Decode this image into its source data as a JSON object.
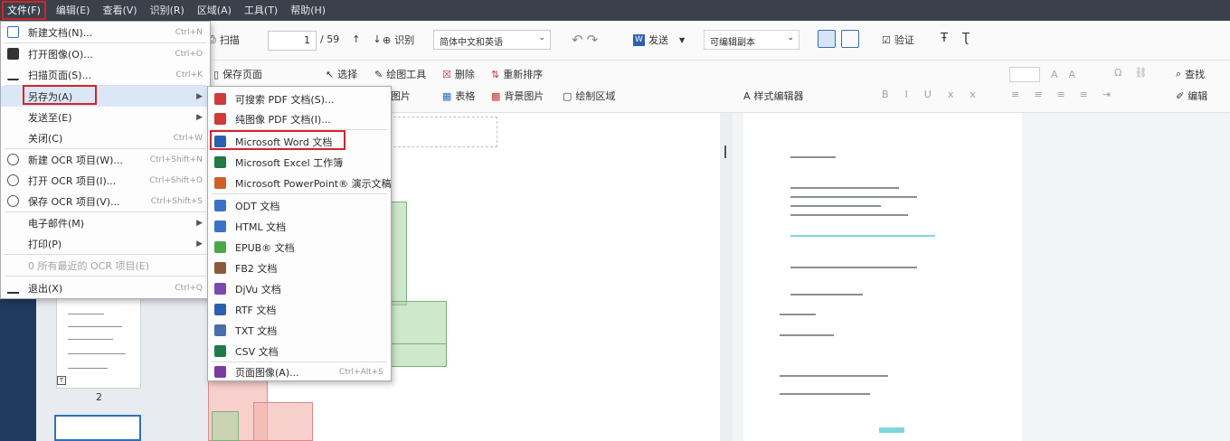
{
  "menubar": {
    "items": [
      "文件(F)",
      "编辑(E)",
      "查看(V)",
      "识别(R)",
      "区域(A)",
      "工具(T)",
      "帮助(H)"
    ]
  },
  "toolbar": {
    "scan": "扫描",
    "page_value": "1",
    "page_total": "/ 59",
    "recognize": "识别",
    "language": "简体中文和英语",
    "send": "发送",
    "send_target": "可编辑副本",
    "verify": "验证"
  },
  "toolbar2": {
    "save_page": "保存页面",
    "select": "选择",
    "draw_tools": "绘图工具",
    "delete": "删除",
    "reorder": "重新排序",
    "picture": "图片",
    "table": "表格",
    "bg_picture": "背景图片",
    "draw_region": "绘制区域",
    "style_editor": "样式编辑器",
    "find": "查找",
    "edit": "编辑"
  },
  "thumbs": {
    "page2_num": "2"
  },
  "file_menu": {
    "items": [
      {
        "label": "新建文档(N)...",
        "shortcut": "Ctrl+N",
        "icon": "new-doc-icon",
        "arrow": false
      },
      {
        "label": "打开图像(O)...",
        "shortcut": "Ctrl+O",
        "icon": "folder-icon",
        "arrow": false
      },
      {
        "label": "扫描页面(S)...",
        "shortcut": "Ctrl+K",
        "icon": "scan-icon",
        "arrow": false
      },
      {
        "label": "另存为(A)",
        "shortcut": "",
        "icon": "",
        "arrow": true
      },
      {
        "label": "发送至(E)",
        "shortcut": "",
        "icon": "",
        "arrow": true
      },
      {
        "label": "关闭(C)",
        "shortcut": "Ctrl+W",
        "icon": "",
        "arrow": false
      },
      {
        "label": "新建 OCR 项目(W)...",
        "shortcut": "Ctrl+Shift+N",
        "icon": "ocr-new-icon",
        "arrow": false
      },
      {
        "label": "打开 OCR 项目(I)...",
        "shortcut": "Ctrl+Shift+O",
        "icon": "ocr-open-icon",
        "arrow": false
      },
      {
        "label": "保存 OCR 项目(V)...",
        "shortcut": "Ctrl+Shift+S",
        "icon": "ocr-save-icon",
        "arrow": false
      },
      {
        "label": "电子邮件(M)",
        "shortcut": "",
        "icon": "",
        "arrow": true
      },
      {
        "label": "打印(P)",
        "shortcut": "",
        "icon": "",
        "arrow": true
      },
      {
        "label": "0 所有最近的 OCR 项目(E)",
        "shortcut": "",
        "icon": "",
        "arrow": false
      },
      {
        "label": "退出(X)",
        "shortcut": "Ctrl+Q",
        "icon": "exit-icon",
        "arrow": false
      }
    ]
  },
  "saveas_menu": {
    "items": [
      {
        "label": "可搜索 PDF 文档(S)...",
        "color": "#d03a3a"
      },
      {
        "label": "纯图像 PDF 文档(I)...",
        "color": "#d03a3a"
      },
      {
        "label": "Microsoft Word 文档",
        "color": "#2b5fb0"
      },
      {
        "label": "Microsoft Excel 工作簿",
        "color": "#1f7a45"
      },
      {
        "label": "Microsoft PowerPoint® 演示文稿",
        "color": "#d0602a"
      },
      {
        "label": "ODT 文档",
        "color": "#3b72c4"
      },
      {
        "label": "HTML 文档",
        "color": "#3b72c4"
      },
      {
        "label": "EPUB® 文档",
        "color": "#4aa84a"
      },
      {
        "label": "FB2 文档",
        "color": "#8a5a3a"
      },
      {
        "label": "DjVu 文档",
        "color": "#7a4ab0"
      },
      {
        "label": "RTF 文档",
        "color": "#2b5fb0"
      },
      {
        "label": "TXT 文档",
        "color": "#4a6fa8"
      },
      {
        "label": "CSV 文档",
        "color": "#1f7a45"
      },
      {
        "label": "页面图像(A)...",
        "color": "#7a3aa0",
        "shortcut": "Ctrl+Alt+S"
      }
    ]
  },
  "colors": {
    "menubar_bg": "#3a414b",
    "highlight": "#d3242b",
    "sidebar": "#1f3a5c"
  }
}
